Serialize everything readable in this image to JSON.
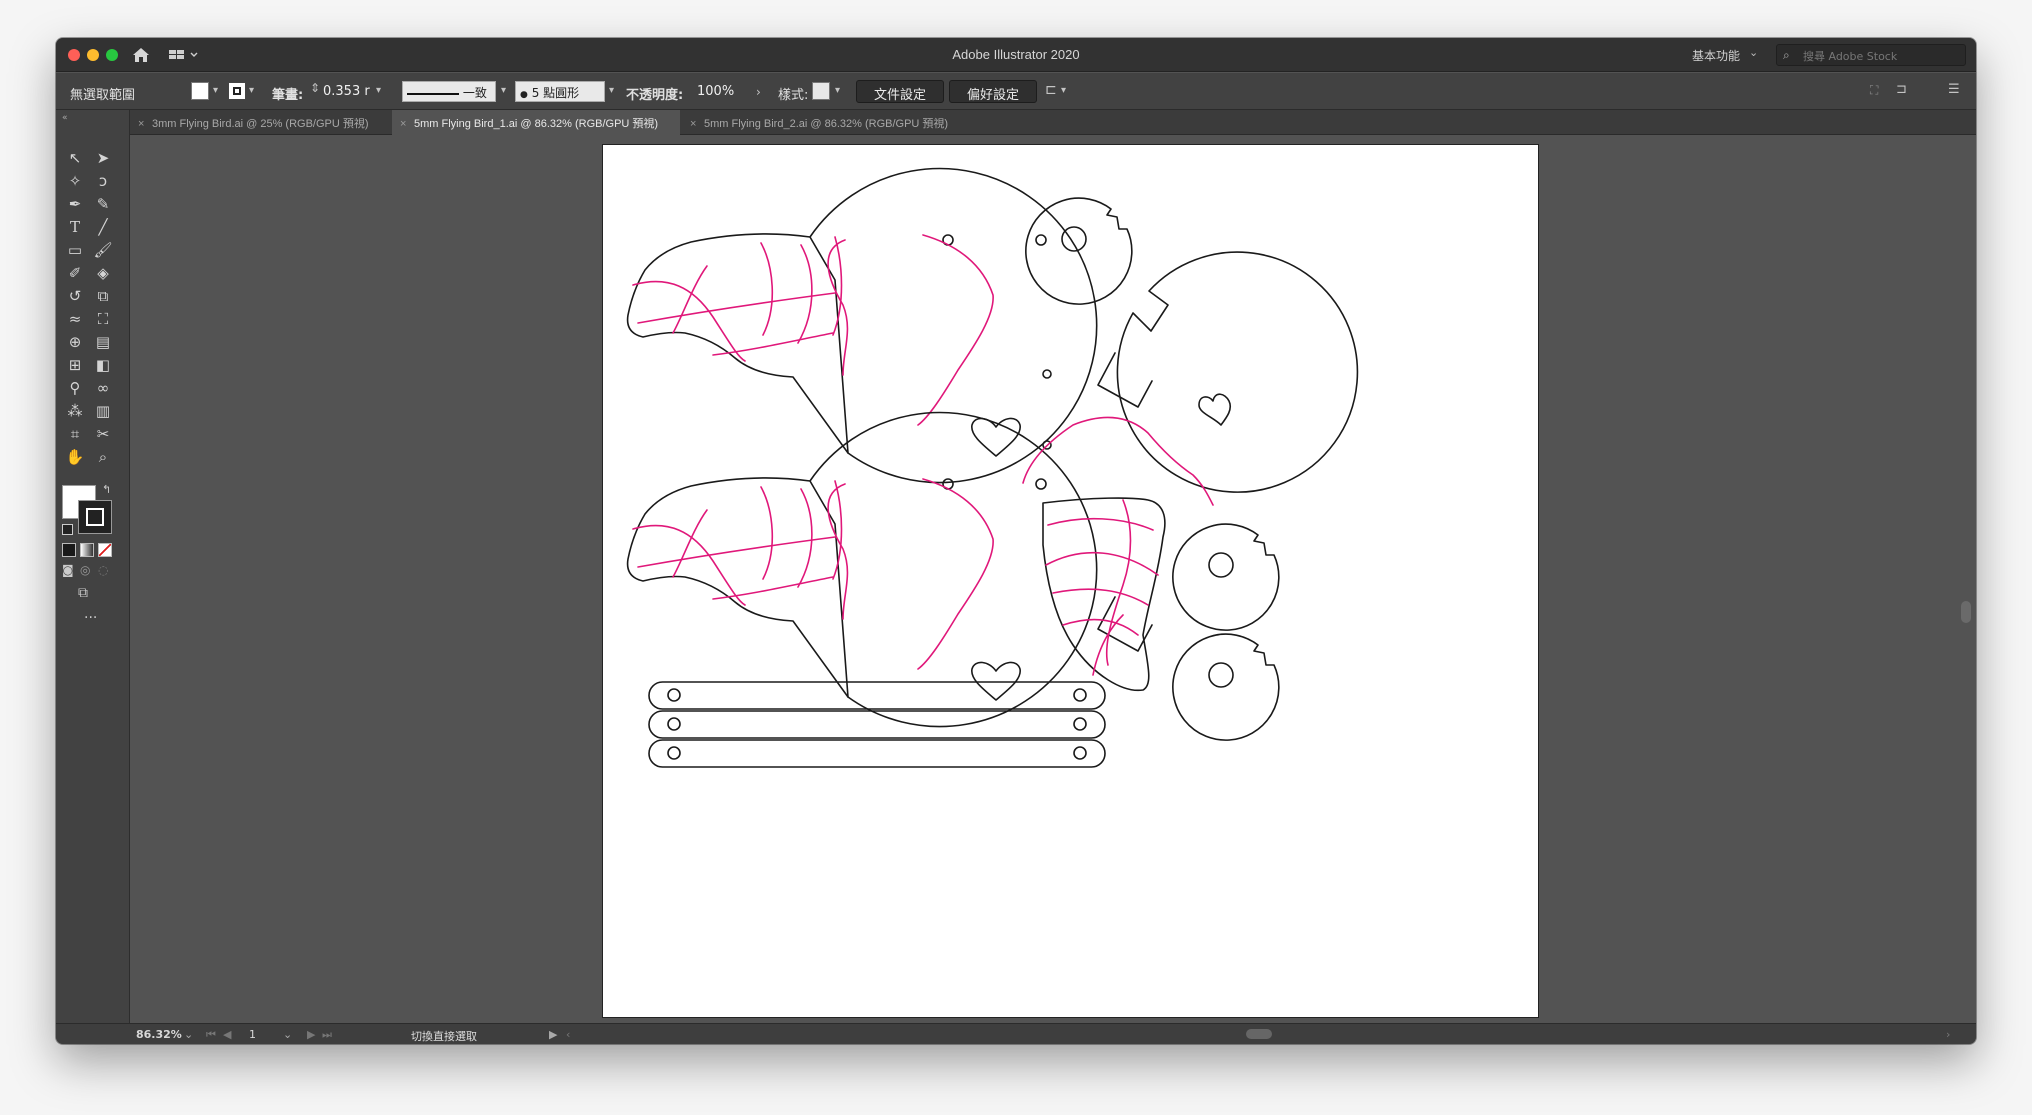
{
  "window": {
    "title": "Adobe Illustrator 2020"
  },
  "workspace": {
    "label": "基本功能"
  },
  "search": {
    "placeholder": "搜尋 Adobe Stock"
  },
  "control_bar": {
    "selection_label": "無選取範圍",
    "stroke_label": "筆畫:",
    "stroke_value": "0.353 r",
    "stroke_profile": "一致",
    "brush_label": "5 點圓形",
    "opacity_label": "不透明度:",
    "opacity_value": "100%",
    "style_label": "樣式:",
    "doc_setup_button": "文件設定",
    "prefs_button": "偏好設定"
  },
  "tabs": [
    {
      "label": "3mm Flying Bird.ai @ 25% (RGB/GPU 預視)",
      "active": false
    },
    {
      "label": "5mm Flying Bird_1.ai @ 86.32% (RGB/GPU 預視)",
      "active": true
    },
    {
      "label": "5mm Flying Bird_2.ai @ 86.32% (RGB/GPU 預視)",
      "active": false
    }
  ],
  "status_bar": {
    "zoom": "86.32%",
    "artboard_number": "1",
    "tool_status": "切換直接選取"
  },
  "colors": {
    "cut_line": "#1a1a1a",
    "engrave_line": "#e0187a",
    "chrome_dark": "#323232",
    "panel": "#424242",
    "canvas": "#535353"
  },
  "tools": [
    "selection-tool",
    "direct-selection-tool",
    "magic-wand-tool",
    "lasso-tool",
    "pen-tool",
    "curvature-tool",
    "type-tool",
    "line-tool",
    "rectangle-tool",
    "paintbrush-tool",
    "shaper-tool",
    "eraser-tool",
    "rotate-tool",
    "scale-tool",
    "warp-tool",
    "free-transform-tool",
    "shape-builder-tool",
    "perspective-grid-tool",
    "mesh-tool",
    "gradient-tool",
    "eyedropper-tool",
    "blend-tool",
    "symbol-sprayer-tool",
    "column-graph-tool",
    "artboard-tool",
    "slice-tool",
    "hand-tool",
    "zoom-tool"
  ]
}
